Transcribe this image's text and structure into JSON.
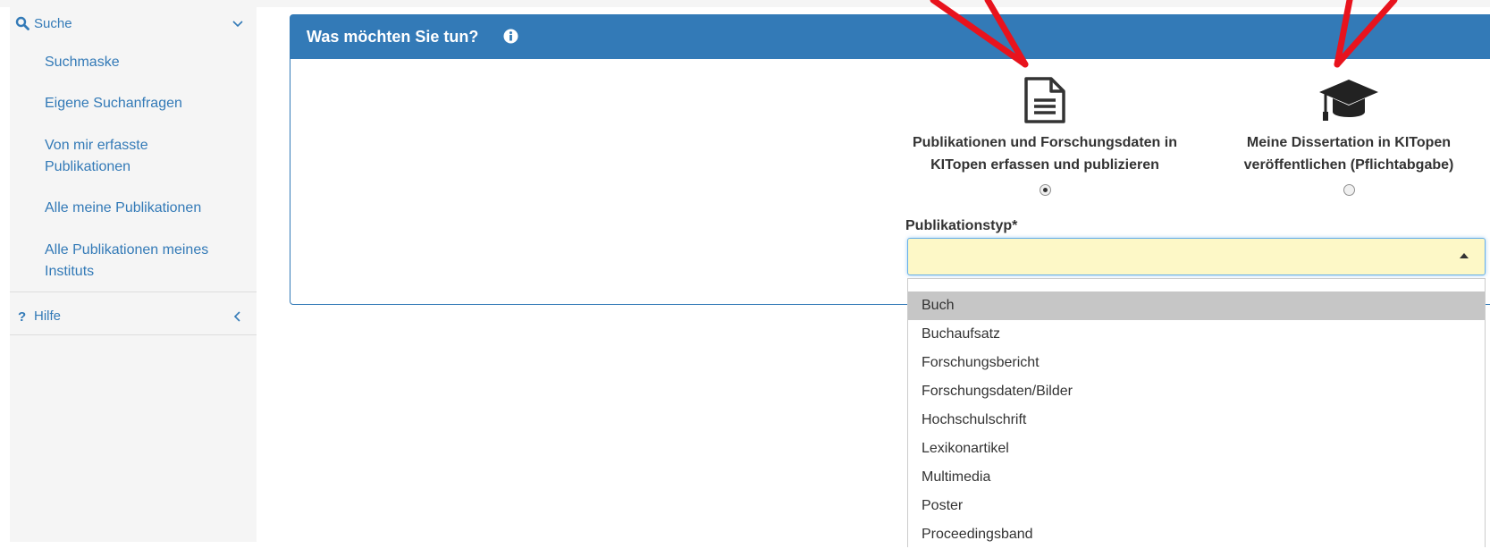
{
  "sidebar": {
    "search": {
      "label": "Suche"
    },
    "items": [
      {
        "label": "Suchmaske"
      },
      {
        "label": "Eigene Suchanfragen"
      },
      {
        "label": "Von mir erfasste Publikationen"
      },
      {
        "label": "Alle meine Publikationen"
      },
      {
        "label": "Alle Publikationen meines Instituts"
      }
    ],
    "help": {
      "label": "Hilfe"
    }
  },
  "panel": {
    "title": "Was möchten Sie tun?",
    "options": [
      {
        "label": "Publikationen und Forschungsdaten in KITopen erfassen und publizieren",
        "icon": "document-icon",
        "selected": true
      },
      {
        "label": "Meine Dissertation in KITopen veröffentlichen (Pflichtabgabe)",
        "icon": "graduation-cap-icon",
        "selected": false
      }
    ],
    "publication_type": {
      "label": "Publikationstyp",
      "required_marker": "*",
      "value": "",
      "options": [
        "Buch",
        "Buchaufsatz",
        "Forschungsbericht",
        "Forschungsdaten/Bilder",
        "Hochschulschrift",
        "Lexikonartikel",
        "Multimedia",
        "Poster",
        "Proceedingsband"
      ],
      "highlighted": "Buch"
    }
  },
  "colors": {
    "primary": "#337ab7",
    "select_background": "#fdf8c7",
    "highlight": "#c6c6c6",
    "annotation_arrow": "#e8131d"
  }
}
